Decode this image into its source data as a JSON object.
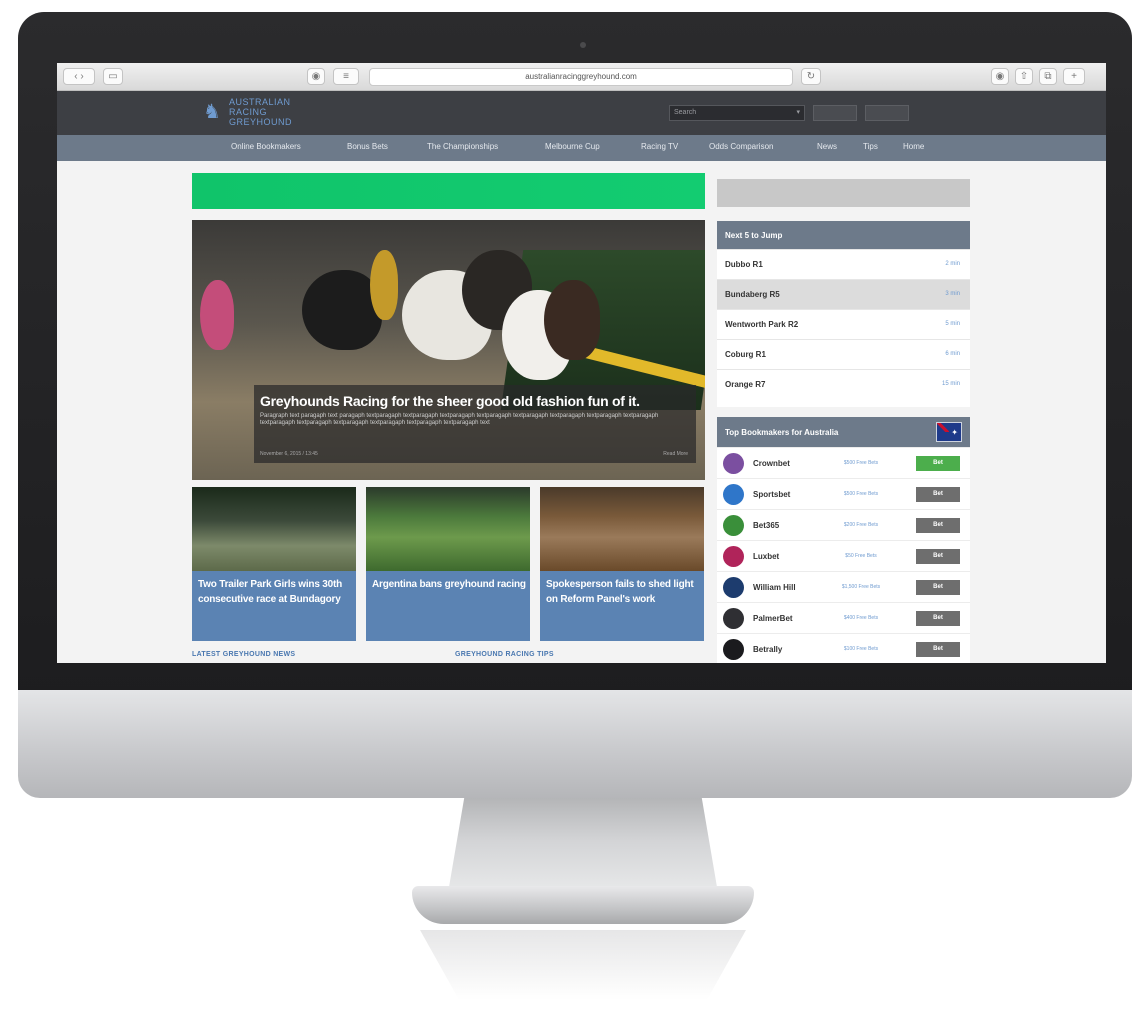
{
  "browser": {
    "url": "australianracinggreyhound.com",
    "search_placeholder": "Search"
  },
  "site": {
    "logo_lines": [
      "AUSTRALIAN",
      "RACING",
      "GREYHOUND"
    ],
    "nav": [
      "Online Bookmakers",
      "Bonus Bets",
      "The Championships",
      "Melbourne Cup",
      "Racing TV",
      "Odds Comparison",
      "News",
      "Tips",
      "Home"
    ]
  },
  "hero": {
    "title": "Greyhounds Racing for the sheer good old fashion fun of it.",
    "text": "Paragraph text paragaph text paragaph textparagaph textparagaph textparagaph textparagaph textparagaph textparagaph textparagaph textparagaph textparagaph textparagaph textparagaph textparagaph textparagaph textparagaph text",
    "meta": "November 6, 2015 / 13:45",
    "more": "Read More"
  },
  "cards": [
    {
      "title": "Two Trailer Park Girls wins 30th consecutive race at Bundagory"
    },
    {
      "title": "Argentina bans greyhound racing"
    },
    {
      "title": "Spokesperson fails to shed light on Reform Panel's work"
    }
  ],
  "sections": {
    "latest_news": "LATEST GREYHOUND NEWS",
    "racing_tips": "GREYHOUND RACING TIPS"
  },
  "next_to_jump": {
    "title": "Next 5 to Jump",
    "races": [
      {
        "name": "Dubbo R1",
        "time": "2 min"
      },
      {
        "name": "Bundaberg R5",
        "time": "3 min"
      },
      {
        "name": "Wentworth Park R2",
        "time": "5 min"
      },
      {
        "name": "Coburg R1",
        "time": "6 min"
      },
      {
        "name": "Orange R7",
        "time": "15 min"
      }
    ]
  },
  "bookmakers": {
    "title": "Top Bookmakers for Australia",
    "bet_label": "Bet",
    "items": [
      {
        "name": "Crownbet",
        "offer": "$500 Free Bets",
        "color": "#7b4fa0"
      },
      {
        "name": "Sportsbet",
        "offer": "$500 Free Bets",
        "color": "#2f76c9"
      },
      {
        "name": "Bet365",
        "offer": "$200 Free Bets",
        "color": "#3a8f3a"
      },
      {
        "name": "Luxbet",
        "offer": "$50 Free Bets",
        "color": "#b0245a"
      },
      {
        "name": "William Hill",
        "offer": "$1,500 Free Bets",
        "color": "#1d3c6e"
      },
      {
        "name": "PalmerBet",
        "offer": "$400 Free Bets",
        "color": "#2f2f33"
      },
      {
        "name": "Betrally",
        "offer": "$100 Free Bets",
        "color": "#1b1b1e"
      }
    ]
  }
}
